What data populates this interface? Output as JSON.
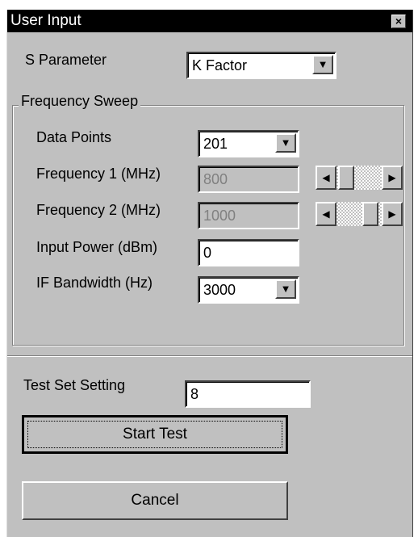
{
  "window": {
    "title": "User Input",
    "close_glyph": "×"
  },
  "s_parameter": {
    "label": "S Parameter",
    "selected": "K Factor"
  },
  "frequency_sweep": {
    "group_label": "Frequency Sweep",
    "data_points": {
      "label": "Data Points",
      "selected": "201"
    },
    "frequency1": {
      "label": "Frequency 1 (MHz)",
      "value": "800",
      "disabled": true,
      "slider_position": 0.1
    },
    "frequency2": {
      "label": "Frequency 2 (MHz)",
      "value": "1000",
      "disabled": true,
      "slider_position": 0.9
    },
    "input_power": {
      "label": "Input Power (dBm)",
      "value": "0"
    },
    "if_bandwidth": {
      "label": "IF Bandwidth (Hz)",
      "selected": "3000"
    }
  },
  "test_set": {
    "label": "Test Set Setting",
    "value": "8"
  },
  "buttons": {
    "start": "Start Test",
    "cancel": "Cancel"
  },
  "icons": {
    "dropdown": "chevron-down-icon",
    "left": "arrow-left-icon",
    "right": "arrow-right-icon",
    "close": "close-icon"
  }
}
